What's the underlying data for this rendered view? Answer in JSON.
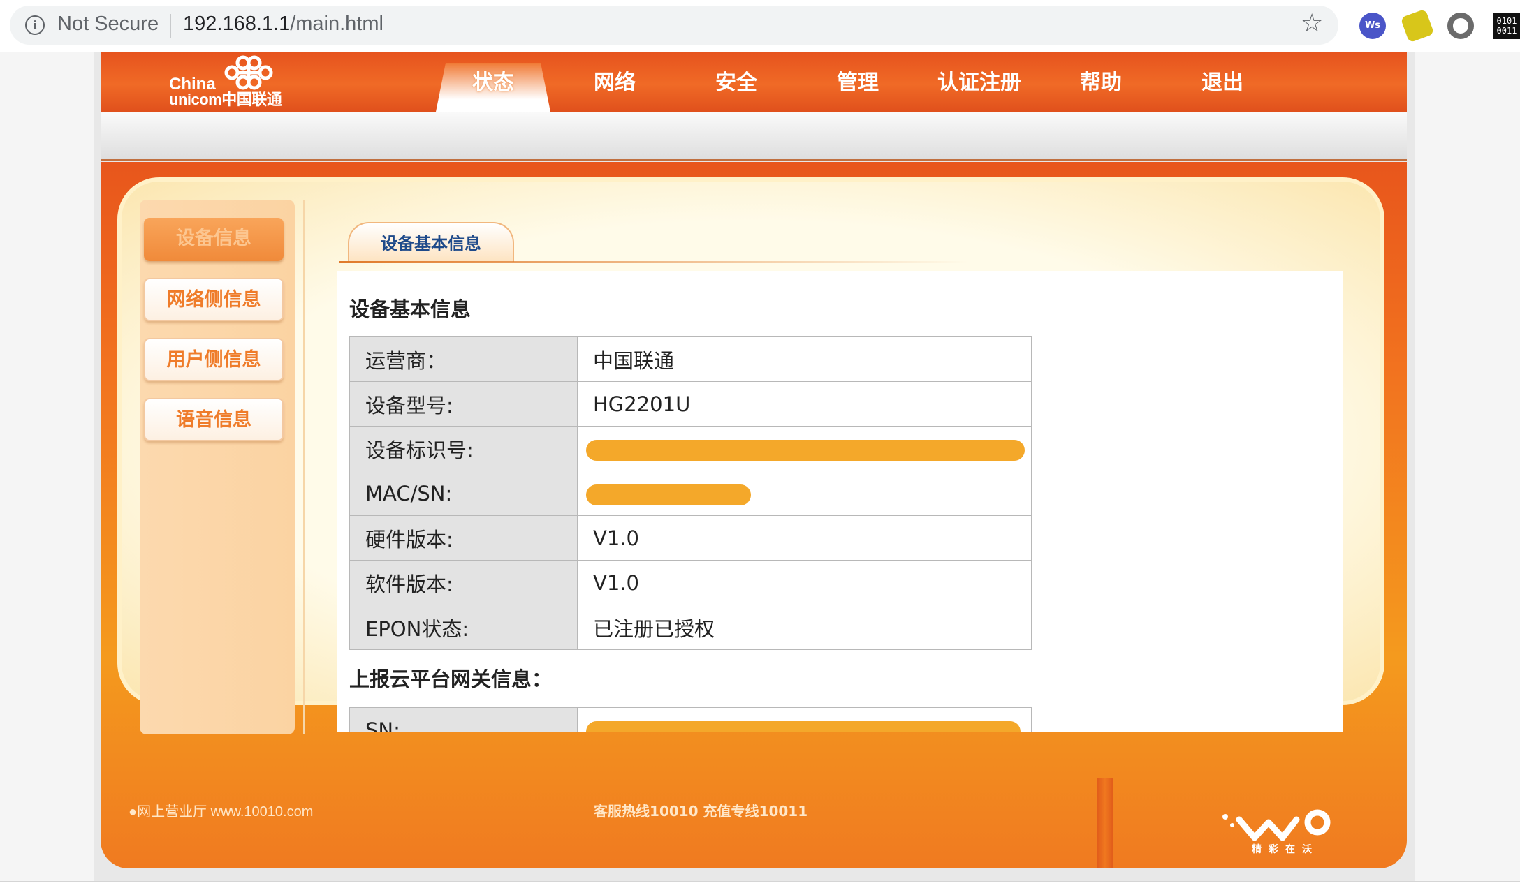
{
  "browser": {
    "security_label": "Not Secure",
    "url_host": "192.168.1.1",
    "url_path": "/main.html",
    "ext1_label": "Ws",
    "ext4_label": "0101\n0011"
  },
  "header": {
    "logo_line1": "China",
    "logo_line2": "unicom中国联通",
    "nav": [
      "状态",
      "网络",
      "安全",
      "管理",
      "认证注册",
      "帮助",
      "退出"
    ],
    "active_nav": "状态"
  },
  "sidebar": {
    "items": [
      "设备信息",
      "网络侧信息",
      "用户侧信息",
      "语音信息"
    ],
    "active": "设备信息"
  },
  "content": {
    "tab_label": "设备基本信息",
    "section1_title": "设备基本信息",
    "rows": [
      {
        "label": "运营商：",
        "value": "中国联通"
      },
      {
        "label": "设备型号:",
        "value": "HG2201U"
      },
      {
        "label": "设备标识号:",
        "value": "",
        "redacted": true
      },
      {
        "label": "MAC/SN:",
        "value": "",
        "redacted": true
      },
      {
        "label": "硬件版本:",
        "value": "V1.0"
      },
      {
        "label": "软件版本:",
        "value": "V1.0"
      },
      {
        "label": "EPON状态:",
        "value": "已注册已授权"
      }
    ],
    "section2_title": "上报云平台网关信息：",
    "rows2": [
      {
        "label": "SN:",
        "value": "",
        "redacted": true
      }
    ]
  },
  "footer": {
    "left_text": "●网上营业厅 www.10010.com",
    "center_text": "客服热线10010   充值专线10011",
    "brand_text": "精彩在沃"
  },
  "colors": {
    "brand_orange": "#f06a26",
    "redaction": "#f4a82a",
    "tab_text": "#1e4a8a"
  }
}
